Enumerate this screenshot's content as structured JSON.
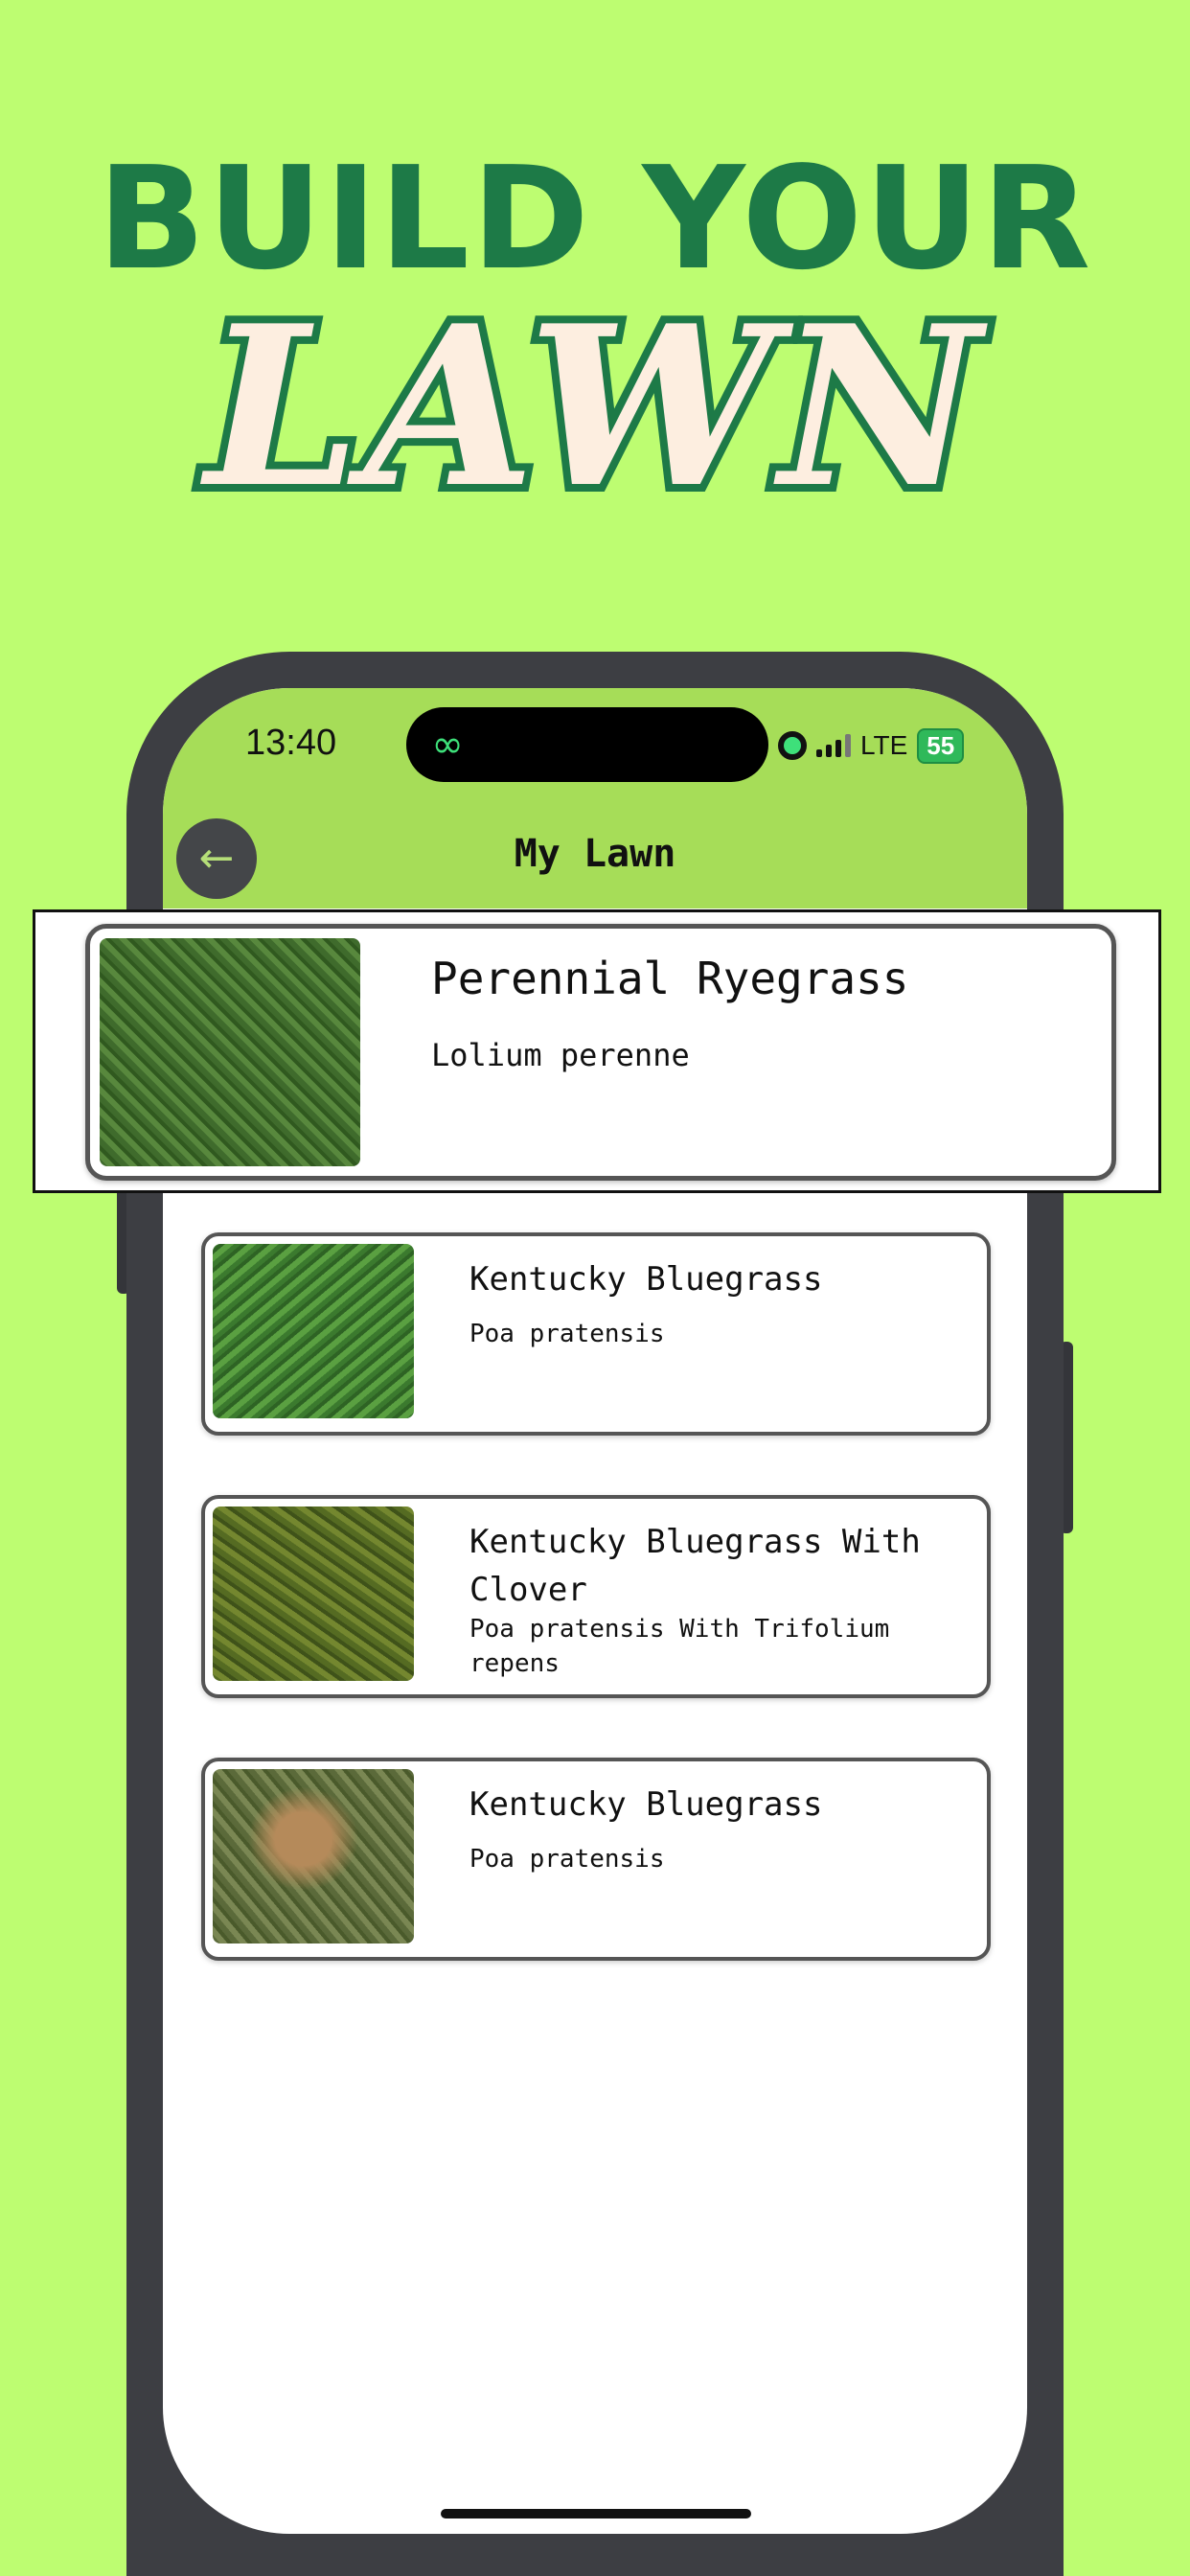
{
  "hero": {
    "line1": "BUILD YOUR",
    "line2": "LAWN"
  },
  "status_bar": {
    "time": "13:40",
    "network": "LTE",
    "battery": "55"
  },
  "island_icon": "link-rings-icon",
  "appbar": {
    "title": "My Lawn",
    "back_icon": "arrow-left-icon"
  },
  "highlighted": {
    "name": "Perennial Ryegrass",
    "scientific": "Lolium perenne"
  },
  "lawn_items": [
    {
      "name": "Kentucky Bluegrass",
      "scientific": "Poa pratensis"
    },
    {
      "name": "Kentucky Bluegrass With Clover",
      "scientific": "Poa pratensis With Trifolium repens"
    },
    {
      "name": "Kentucky Bluegrass",
      "scientific": "Poa pratensis"
    }
  ],
  "colors": {
    "background": "#bdfd71",
    "brand_green": "#1d7a47",
    "appbar": "#a6dd58",
    "cream": "#fdeee0"
  }
}
